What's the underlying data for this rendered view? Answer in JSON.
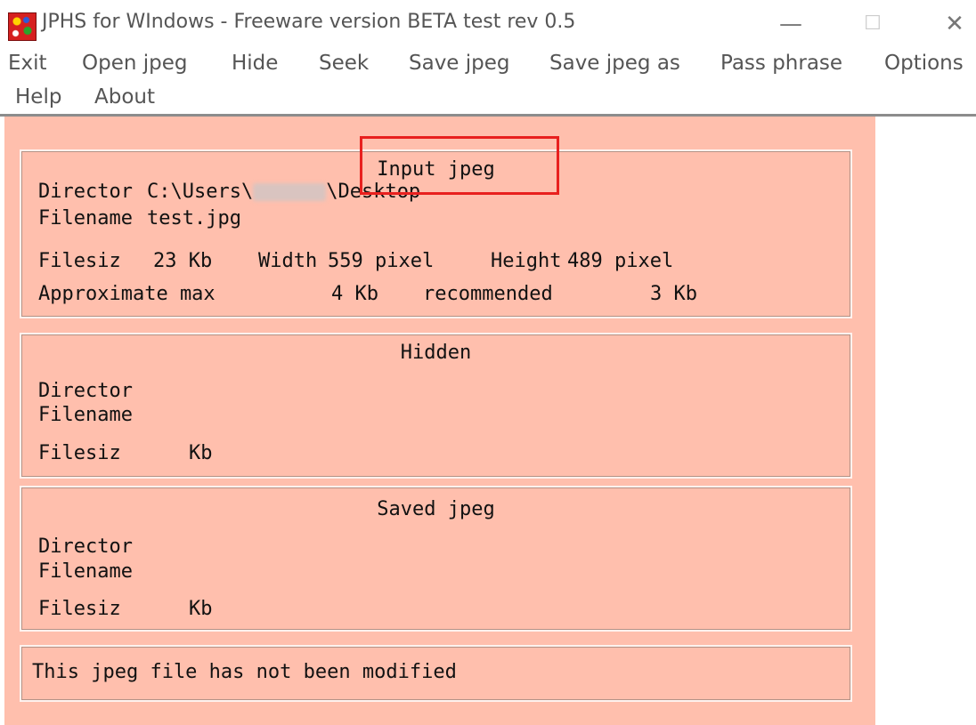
{
  "window": {
    "title": "JPHS for WIndows - Freeware version BETA test rev 0.5",
    "minimize_glyph": "—",
    "maximize_glyph": "☐",
    "close_glyph": "✕"
  },
  "menu": {
    "exit": "Exit",
    "open_jpeg": "Open jpeg",
    "hide": "Hide",
    "seek": "Seek",
    "save_jpeg": "Save jpeg",
    "save_jpeg_as": "Save jpeg as",
    "pass_phrase": "Pass phrase",
    "options": "Options",
    "help": "Help",
    "about": "About"
  },
  "input_jpeg": {
    "heading": "Input jpeg",
    "directory_label": "Director",
    "directory_value_start": "C:\\Users\\",
    "directory_value_end": "\\Desktop",
    "filename_label": "Filename",
    "filename_value": "test.jpg",
    "filesize_label": "Filesiz",
    "filesize_value": "23 Kb",
    "width_label": "Width",
    "width_value": "559 pixel",
    "height_label": "Height",
    "height_value": "489 pixel",
    "approx_max_label": "Approximate max",
    "approx_max_value": "4 Kb",
    "recommended_label": "recommended",
    "recommended_value": "3 Kb"
  },
  "hidden": {
    "heading": "Hidden",
    "directory_label": "Director",
    "filename_label": "Filename",
    "filesize_label": "Filesiz",
    "filesize_unit": "Kb"
  },
  "saved_jpeg": {
    "heading": "Saved jpeg",
    "directory_label": "Director",
    "filename_label": "Filename",
    "filesize_label": "Filesiz",
    "filesize_unit": "Kb"
  },
  "status": {
    "message": "This jpeg file has not been modified"
  },
  "colors": {
    "client_bg": "#ffbfad",
    "annotation_box": "#e8201e"
  }
}
